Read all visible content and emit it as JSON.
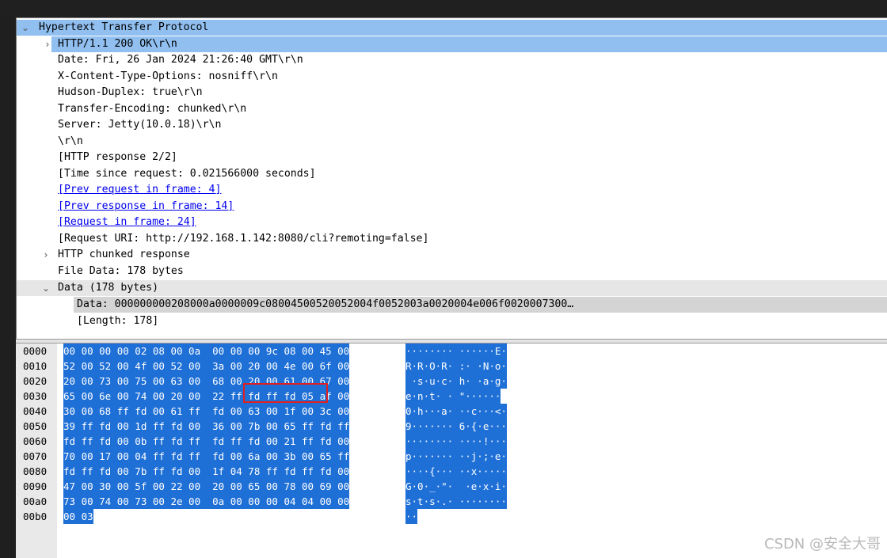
{
  "tree": {
    "rows": [
      {
        "arrow": "⌄",
        "text": "Hypertext Transfer Protocol"
      },
      {
        "arrow": "›",
        "text": "HTTP/1.1 200 OK\\r\\n"
      },
      {
        "arrow": "",
        "text": "Date: Fri, 26 Jan 2024 21:26:40 GMT\\r\\n"
      },
      {
        "arrow": "",
        "text": "X-Content-Type-Options: nosniff\\r\\n"
      },
      {
        "arrow": "",
        "text": "Hudson-Duplex: true\\r\\n"
      },
      {
        "arrow": "",
        "text": "Transfer-Encoding: chunked\\r\\n"
      },
      {
        "arrow": "",
        "text": "Server: Jetty(10.0.18)\\r\\n"
      },
      {
        "arrow": "",
        "text": "\\r\\n"
      },
      {
        "arrow": "",
        "text": "[HTTP response 2/2]"
      },
      {
        "arrow": "",
        "text": "[Time since request: 0.021566000 seconds]"
      },
      {
        "arrow": "",
        "text": "[Prev request in frame: 4]"
      },
      {
        "arrow": "",
        "text": "[Prev response in frame: 14]"
      },
      {
        "arrow": "",
        "text": "[Request in frame: 24]"
      },
      {
        "arrow": "",
        "text": "[Request URI: http://192.168.1.142:8080/cli?remoting=false]"
      },
      {
        "arrow": "›",
        "text": "HTTP chunked response"
      },
      {
        "arrow": "",
        "text": "File Data: 178 bytes"
      },
      {
        "arrow": "⌄",
        "text": "Data (178 bytes)"
      },
      {
        "arrow": "",
        "text": "Data: 000000000208000a0000009c08004500520052004f0052003a0020004e006f0020007300…"
      },
      {
        "arrow": "",
        "text": "[Length: 178]"
      }
    ]
  },
  "hex": {
    "rows": [
      {
        "offset": "0000",
        "bytes": "00 00 00 00 02 08 00 0a  00 00 00 9c 08 00 45 00",
        "ascii": "········ ······E·"
      },
      {
        "offset": "0010",
        "bytes": "52 00 52 00 4f 00 52 00  3a 00 20 00 4e 00 6f 00",
        "ascii": "R·R·O·R· :· ·N·o·"
      },
      {
        "offset": "0020",
        "bytes": "20 00 73 00 75 00 63 00  68 00 20 00 61 00 67 00",
        "ascii": " ·s·u·c· h· ·a·g·"
      },
      {
        "offset": "0030",
        "bytes": "65 00 6e 00 74 00 20 00  22 ff fd ff fd 05 af 00",
        "ascii": "e·n·t· · \"······"
      },
      {
        "offset": "0040",
        "bytes": "30 00 68 ff fd 00 61 ff  fd 00 63 00 1f 00 3c 00",
        "ascii": "0·h···a· ··c···<·"
      },
      {
        "offset": "0050",
        "bytes": "39 ff fd 00 1d ff fd 00  36 00 7b 00 65 ff fd ff",
        "ascii": "9······· 6·{·e···"
      },
      {
        "offset": "0060",
        "bytes": "fd ff fd 00 0b ff fd ff  fd ff fd 00 21 ff fd 00",
        "ascii": "········ ····!···"
      },
      {
        "offset": "0070",
        "bytes": "70 00 17 00 04 ff fd ff  fd 00 6a 00 3b 00 65 ff",
        "ascii": "p······· ··j·;·e·"
      },
      {
        "offset": "0080",
        "bytes": "fd ff fd 00 7b ff fd 00  1f 04 78 ff fd ff fd 00",
        "ascii": "····{··· ··x·····"
      },
      {
        "offset": "0090",
        "bytes": "47 00 30 00 5f 00 22 00  20 00 65 00 78 00 69 00",
        "ascii": "G·0·_·\"·  ·e·x·i·"
      },
      {
        "offset": "00a0",
        "bytes": "73 00 74 00 73 00 2e 00  0a 00 00 00 04 04 00 00",
        "ascii": "s·t·s·.· ········"
      },
      {
        "offset": "00b0",
        "bytes": "00 03",
        "ascii": "··"
      }
    ]
  },
  "watermark": "CSDN @安全大哥"
}
